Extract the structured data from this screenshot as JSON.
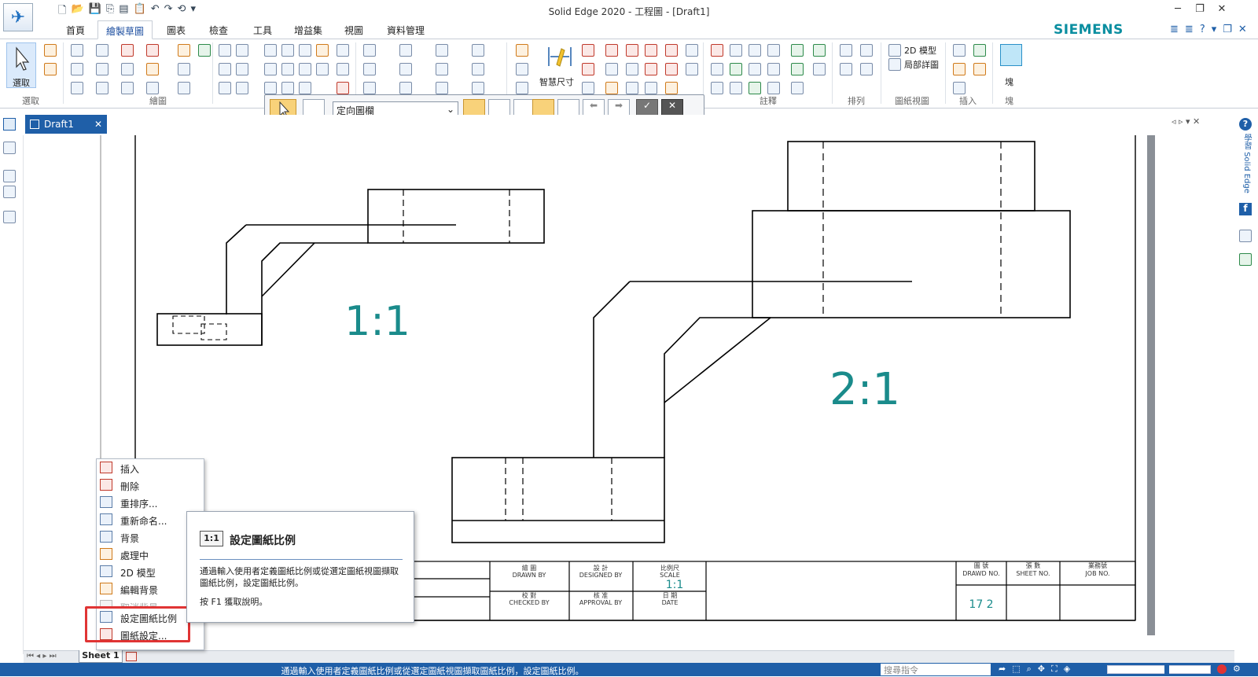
{
  "titlebar": {
    "title": "Solid Edge 2020 - 工程圖 - [Draft1]",
    "brand": "SIEMENS"
  },
  "tabs": [
    {
      "label": "首頁"
    },
    {
      "label": "繪製草圖"
    },
    {
      "label": "圖表"
    },
    {
      "label": "檢查"
    },
    {
      "label": "工具"
    },
    {
      "label": "增益集"
    },
    {
      "label": "視圖"
    },
    {
      "label": "資料管理"
    }
  ],
  "ribbon": {
    "select_label": "選取",
    "smart_dimension_label": "智慧尺寸",
    "model_2d_label": "2D 模型",
    "detail_view_label": "局部詳圖",
    "block_label": "塊",
    "groups": [
      "選取",
      "繪圖",
      "註釋",
      "排列",
      "圖紙視圖",
      "插入",
      "塊"
    ]
  },
  "commandbar": {
    "dropdown_value": "定向圖欄"
  },
  "document": {
    "tab_label": "Draft1"
  },
  "drawing": {
    "scale_small": "1:1",
    "scale_large": "2:1",
    "titleblock": {
      "drawn_zh": "繪 圖",
      "drawn_en": "DRAWN BY",
      "designed_zh": "設 計",
      "designed_en": "DESIGNED BY",
      "scale_zh": "比例尺",
      "scale_en": "SCALE",
      "scale_value": "1:1",
      "checked_zh": "校 對",
      "checked_en": "CHECKED BY",
      "approval_zh": "核 准",
      "approval_en": "APPROVAL BY",
      "date_zh": "日 期",
      "date_en": "DATE",
      "drawno_zh": "圖 號",
      "drawno_en": "DRAWD NO.",
      "sheetno_zh": "張 數",
      "sheetno_en": "SHEET NO.",
      "jobno_zh": "業務號",
      "jobno_en": "JOB NO.",
      "drawno_value": "17 2"
    }
  },
  "context_menu": {
    "items": [
      {
        "label": "插入",
        "dim": false
      },
      {
        "label": "刪除",
        "dim": false
      },
      {
        "label": "重排序...",
        "dim": false
      },
      {
        "label": "重新命名...",
        "dim": false
      },
      {
        "label": "背景",
        "dim": false
      },
      {
        "label": "處理中",
        "dim": false
      },
      {
        "label": "2D 模型",
        "dim": false
      },
      {
        "label": "編輯背景",
        "dim": false
      },
      {
        "label": "取消背景",
        "dim": true
      },
      {
        "label": "設定圖紙比例",
        "dim": false
      },
      {
        "label": "圖紙設定...",
        "dim": false
      }
    ]
  },
  "tooltip": {
    "icon_text": "1:1",
    "title": "設定圖紙比例",
    "description": "通過輸入使用者定義圖紙比例或從選定圖紙視圖擷取圖紙比例，設定圖紙比例。",
    "help": "按 F1 獲取說明。"
  },
  "sheets": {
    "active": "Sheet 1"
  },
  "status": {
    "text": "通過輸入使用者定義圖紙比例或從選定圖紙視圖擷取圖紙比例，設定圖紙比例。",
    "search_placeholder": "搜尋指令"
  },
  "rightbar": {
    "learn_label": "學習 Solid Edge"
  },
  "colors": {
    "accent": "#1f5fa8",
    "scale_text": "#1a8b8b",
    "highlight": "#e03434"
  }
}
